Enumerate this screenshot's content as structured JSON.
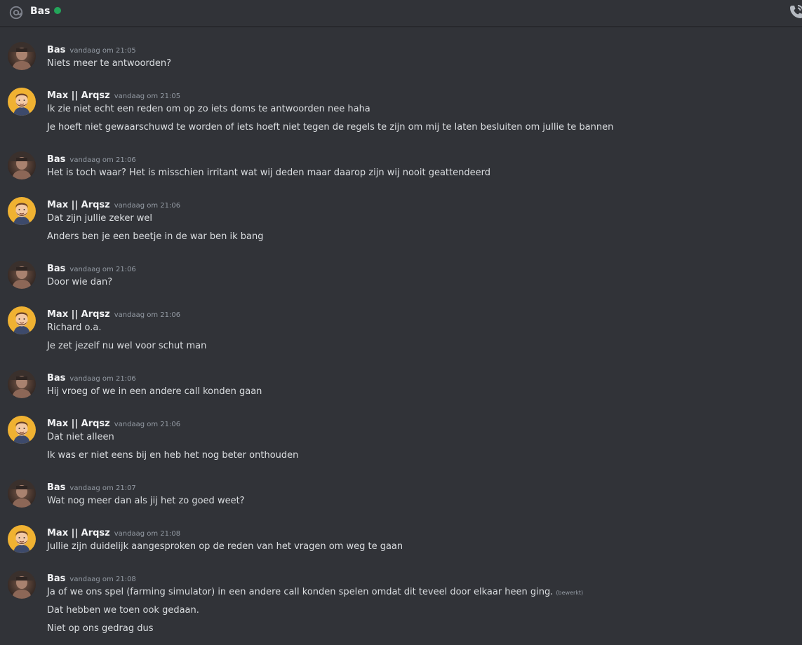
{
  "header": {
    "title": "Bas",
    "status": "online",
    "status_color": "#23a55a",
    "left_icon": "at-icon",
    "right_icon": "voice-call-icon"
  },
  "colors": {
    "background": "#313338",
    "max_avatar_bg": "#f0b232"
  },
  "messages": [
    {
      "author": "Bas",
      "time": "vandaag om 21:05",
      "lines": [
        "Niets meer te antwoorden?"
      ]
    },
    {
      "author": "Max || Arqsz",
      "time": "vandaag om 21:05",
      "lines": [
        "Ik zie niet echt een reden om op zo iets doms te antwoorden nee haha",
        "Je hoeft niet gewaarschuwd te worden of iets hoeft niet tegen de regels te zijn om mij te laten besluiten om jullie te bannen"
      ]
    },
    {
      "author": "Bas",
      "time": "vandaag om 21:06",
      "lines": [
        "Het is toch waar? Het is misschien irritant wat wij deden maar daarop zijn wij nooit geattendeerd"
      ]
    },
    {
      "author": "Max || Arqsz",
      "time": "vandaag om 21:06",
      "lines": [
        "Dat zijn jullie zeker wel",
        "Anders ben je een beetje in de war ben ik bang"
      ]
    },
    {
      "author": "Bas",
      "time": "vandaag om 21:06",
      "lines": [
        "Door wie dan?"
      ]
    },
    {
      "author": "Max || Arqsz",
      "time": "vandaag om 21:06",
      "lines": [
        "Richard o.a.",
        "Je zet jezelf nu wel voor schut man"
      ]
    },
    {
      "author": "Bas",
      "time": "vandaag om 21:06",
      "lines": [
        "Hij vroeg of we in een andere call konden gaan"
      ]
    },
    {
      "author": "Max || Arqsz",
      "time": "vandaag om 21:06",
      "lines": [
        "Dat niet alleen",
        "Ik was er niet eens bij en heb het nog beter onthouden"
      ]
    },
    {
      "author": "Bas",
      "time": "vandaag om 21:07",
      "lines": [
        "Wat nog meer dan als jij het zo goed weet?"
      ]
    },
    {
      "author": "Max || Arqsz",
      "time": "vandaag om 21:08",
      "lines": [
        "Jullie zijn duidelijk aangesproken op de reden van het vragen om weg te gaan"
      ]
    },
    {
      "author": "Bas",
      "time": "vandaag om 21:08",
      "lines": [
        "Ja of we ons spel (farming simulator) in een andere call konden spelen omdat dit teveel door elkaar heen ging.",
        "Dat hebben we toen ook gedaan.",
        "Niet op ons gedrag dus"
      ],
      "edited_label": "(bewerkt)"
    }
  ]
}
